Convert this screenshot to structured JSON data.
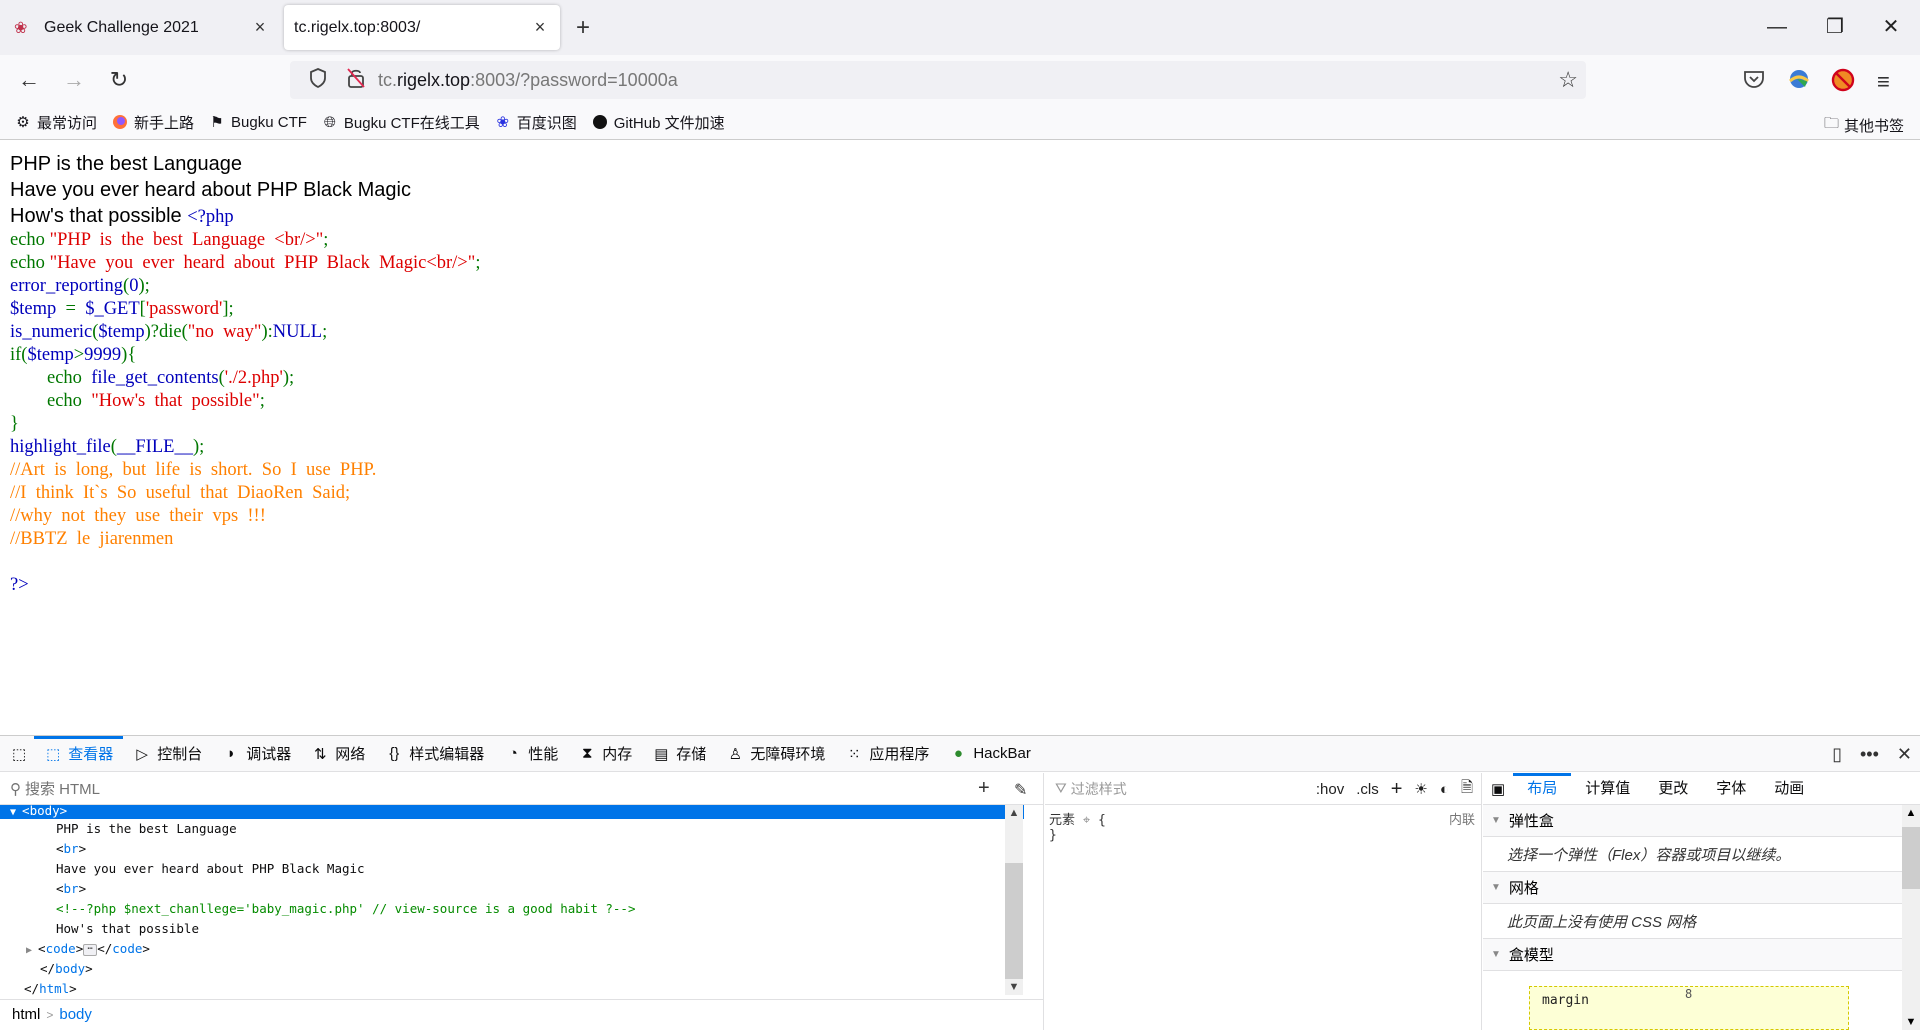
{
  "browser": {
    "tabs": [
      {
        "title": "Geek Challenge 2021",
        "favicon": "red-flower-icon",
        "active": false
      },
      {
        "title": "tc.rigelx.top:8003/",
        "active": true
      }
    ],
    "new_tab": "+",
    "window_controls": {
      "minimize": "—",
      "restore": "❐",
      "close": "✕"
    },
    "nav": {
      "back": "←",
      "forward": "→",
      "reload": "↻"
    },
    "url": {
      "prefix": "tc.",
      "domain": "rigelx.top",
      "suffix": ":8003/?password=10000a"
    },
    "toolbar_icons": [
      "pocket-icon",
      "download-manager-icon",
      "blocked-extension-icon",
      "menu-icon"
    ],
    "bookmarks": [
      {
        "label": "最常访问",
        "icon": "gear-icon"
      },
      {
        "label": "新手上路",
        "icon": "firefox-icon"
      },
      {
        "label": "Bugku CTF",
        "icon": "flag-icon"
      },
      {
        "label": "Bugku CTF在线工具",
        "icon": "globe-icon"
      },
      {
        "label": "百度识图",
        "icon": "baidu-paw-icon"
      },
      {
        "label": "GitHub 文件加速",
        "icon": "github-icon"
      }
    ],
    "other_bookmarks": "其他书签"
  },
  "page": {
    "lines": [
      "PHP is the best Language",
      "Have you ever heard about PHP Black Magic",
      "How's that possible "
    ],
    "code": [
      [
        {
          "c": "c-def",
          "t": "<?php"
        }
      ],
      [
        {
          "c": "c-kw",
          "t": "echo "
        },
        {
          "c": "c-str",
          "t": "\"PHP  is  the  best  Language  <br/>\""
        },
        {
          "c": "c-kw",
          "t": ";"
        }
      ],
      [
        {
          "c": "c-kw",
          "t": "echo "
        },
        {
          "c": "c-str",
          "t": "\"Have  you  ever  heard  about  PHP  Black  Magic<br/>\""
        },
        {
          "c": "c-kw",
          "t": ";"
        }
      ],
      [
        {
          "c": "c-def",
          "t": "error_reporting"
        },
        {
          "c": "c-kw",
          "t": "("
        },
        {
          "c": "c-def",
          "t": "0"
        },
        {
          "c": "c-kw",
          "t": ");"
        }
      ],
      [
        {
          "c": "c-def",
          "t": "$temp  "
        },
        {
          "c": "c-kw",
          "t": "=  "
        },
        {
          "c": "c-def",
          "t": "$_GET"
        },
        {
          "c": "c-kw",
          "t": "["
        },
        {
          "c": "c-str",
          "t": "'password'"
        },
        {
          "c": "c-kw",
          "t": "];"
        }
      ],
      [
        {
          "c": "c-def",
          "t": "is_numeric"
        },
        {
          "c": "c-kw",
          "t": "("
        },
        {
          "c": "c-def",
          "t": "$temp"
        },
        {
          "c": "c-kw",
          "t": ")?die("
        },
        {
          "c": "c-str",
          "t": "\"no  way\""
        },
        {
          "c": "c-kw",
          "t": "):"
        },
        {
          "c": "c-def",
          "t": "NULL"
        },
        {
          "c": "c-kw",
          "t": ";"
        }
      ],
      [
        {
          "c": "c-kw",
          "t": "if("
        },
        {
          "c": "c-def",
          "t": "$temp"
        },
        {
          "c": "c-kw",
          "t": ">"
        },
        {
          "c": "c-def",
          "t": "9999"
        },
        {
          "c": "c-kw",
          "t": "){"
        }
      ],
      [
        {
          "c": "c-kw",
          "t": "        echo  "
        },
        {
          "c": "c-def",
          "t": "file_get_contents"
        },
        {
          "c": "c-kw",
          "t": "("
        },
        {
          "c": "c-str",
          "t": "'./2.php'"
        },
        {
          "c": "c-kw",
          "t": ");"
        }
      ],
      [
        {
          "c": "c-kw",
          "t": "        echo  "
        },
        {
          "c": "c-str",
          "t": "\"How's  that  possible\""
        },
        {
          "c": "c-kw",
          "t": ";"
        }
      ],
      [
        {
          "c": "c-kw",
          "t": "}"
        }
      ],
      [
        {
          "c": "c-def",
          "t": "highlight_file"
        },
        {
          "c": "c-kw",
          "t": "("
        },
        {
          "c": "c-def",
          "t": "__FILE__"
        },
        {
          "c": "c-kw",
          "t": ");"
        }
      ],
      [
        {
          "c": "c-cmt",
          "t": "//Art  is  long,  but  life  is  short.  So  I  use  PHP."
        }
      ],
      [
        {
          "c": "c-cmt",
          "t": "//I  think  It`s  So  useful  that  DiaoRen  Said;"
        }
      ],
      [
        {
          "c": "c-cmt",
          "t": "//why  not  they  use  their  vps  !!!"
        }
      ],
      [
        {
          "c": "c-cmt",
          "t": "//BBTZ  le  jiarenmen"
        }
      ],
      [
        {
          "c": "c-def",
          "t": ""
        }
      ],
      [
        {
          "c": "c-def",
          "t": "?>"
        }
      ]
    ]
  },
  "devtools": {
    "tabs": [
      {
        "label": "查看器",
        "icon": "inspector-icon",
        "active": true
      },
      {
        "label": "控制台",
        "icon": "console-icon"
      },
      {
        "label": "调试器",
        "icon": "debugger-icon"
      },
      {
        "label": "网络",
        "icon": "network-icon"
      },
      {
        "label": "样式编辑器",
        "icon": "style-editor-icon"
      },
      {
        "label": "性能",
        "icon": "performance-icon"
      },
      {
        "label": "内存",
        "icon": "memory-icon"
      },
      {
        "label": "存储",
        "icon": "storage-icon"
      },
      {
        "label": "无障碍环境",
        "icon": "accessibility-icon"
      },
      {
        "label": "应用程序",
        "icon": "application-icon"
      },
      {
        "label": "HackBar",
        "icon": "hackbar-icon"
      }
    ],
    "markup": {
      "search_placeholder": "搜索 HTML",
      "tree": [
        {
          "indent": 1,
          "twisty": "▼",
          "parts": [
            [
              "tag",
              "<body>"
            ]
          ],
          "selected": true
        },
        {
          "indent": 3,
          "parts": [
            [
              "text",
              "PHP is the best Language"
            ]
          ]
        },
        {
          "indent": 3,
          "parts": [
            [
              "text",
              "<"
            ],
            [
              "tag",
              "br"
            ],
            [
              "text",
              ">"
            ]
          ]
        },
        {
          "indent": 3,
          "parts": [
            [
              "text",
              "Have you ever heard about PHP Black Magic"
            ]
          ]
        },
        {
          "indent": 3,
          "parts": [
            [
              "text",
              "<"
            ],
            [
              "tag",
              "br"
            ],
            [
              "text",
              ">"
            ]
          ]
        },
        {
          "indent": 3,
          "parts": [
            [
              "cmt",
              "<!--?php $next_chanllege='baby_magic.php' // view-source is a good habit ?-->"
            ]
          ]
        },
        {
          "indent": 3,
          "parts": [
            [
              "text",
              "How's that possible"
            ]
          ]
        },
        {
          "indent": 2,
          "twisty": "▶",
          "parts": [
            [
              "text",
              "<"
            ],
            [
              "tag",
              "code"
            ],
            [
              "text",
              ">"
            ],
            [
              "ell",
              "⋯"
            ],
            [
              "text",
              "</"
            ],
            [
              "tag",
              "code"
            ],
            [
              "text",
              ">"
            ]
          ]
        },
        {
          "indent": 2,
          "parts": [
            [
              "text",
              "</"
            ],
            [
              "tag",
              "body"
            ],
            [
              "text",
              ">"
            ]
          ]
        },
        {
          "indent": 1,
          "parts": [
            [
              "text",
              "</"
            ],
            [
              "tag",
              "html"
            ],
            [
              "text",
              ">"
            ]
          ]
        }
      ],
      "breadcrumb": [
        "html",
        "body"
      ]
    },
    "rules": {
      "filter_placeholder": "过滤样式",
      "hov": ":hov",
      "cls": ".cls",
      "element_label": "元素",
      "open_brace": "{",
      "close_brace": "}",
      "source": "内联"
    },
    "layout": {
      "tabs": [
        {
          "label": "布局",
          "active": true
        },
        {
          "label": "计算值"
        },
        {
          "label": "更改"
        },
        {
          "label": "字体"
        },
        {
          "label": "动画"
        }
      ],
      "sections": [
        {
          "title": "弹性盒",
          "body": "选择一个弹性（Flex）容器或项目以继续。"
        },
        {
          "title": "网格",
          "body": "此页面上没有使用 CSS 网格"
        },
        {
          "title": "盒模型"
        }
      ],
      "box_model": {
        "label": "margin",
        "top": "8"
      }
    }
  }
}
